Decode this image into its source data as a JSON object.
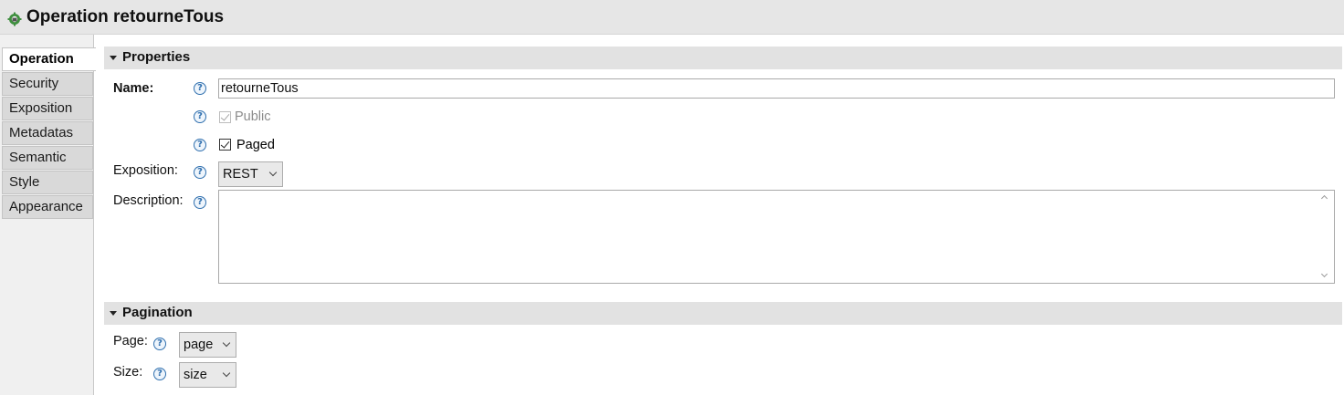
{
  "header": {
    "title": "Operation retourneTous",
    "icon": "operation-gear-icon"
  },
  "tabs": [
    {
      "label": "Operation",
      "active": true
    },
    {
      "label": "Security",
      "active": false
    },
    {
      "label": "Exposition",
      "active": false
    },
    {
      "label": "Metadatas",
      "active": false
    },
    {
      "label": "Semantic",
      "active": false
    },
    {
      "label": "Style",
      "active": false
    },
    {
      "label": "Appearance",
      "active": false
    }
  ],
  "properties": {
    "section_title": "Properties",
    "name_label": "Name:",
    "name_value": "retourneTous",
    "public_label": "Public",
    "public_checked": true,
    "public_enabled": false,
    "paged_label": "Paged",
    "paged_checked": true,
    "exposition_label": "Exposition:",
    "exposition_value": "REST",
    "description_label": "Description:",
    "description_value": ""
  },
  "pagination": {
    "section_title": "Pagination",
    "page_label": "Page:",
    "page_value": "page",
    "size_label": "Size:",
    "size_value": "size"
  },
  "help_glyph": "?",
  "colors": {
    "header_bg": "#e6e6e6",
    "section_bg": "#e2e2e2",
    "help_blue": "#2f6fae"
  }
}
